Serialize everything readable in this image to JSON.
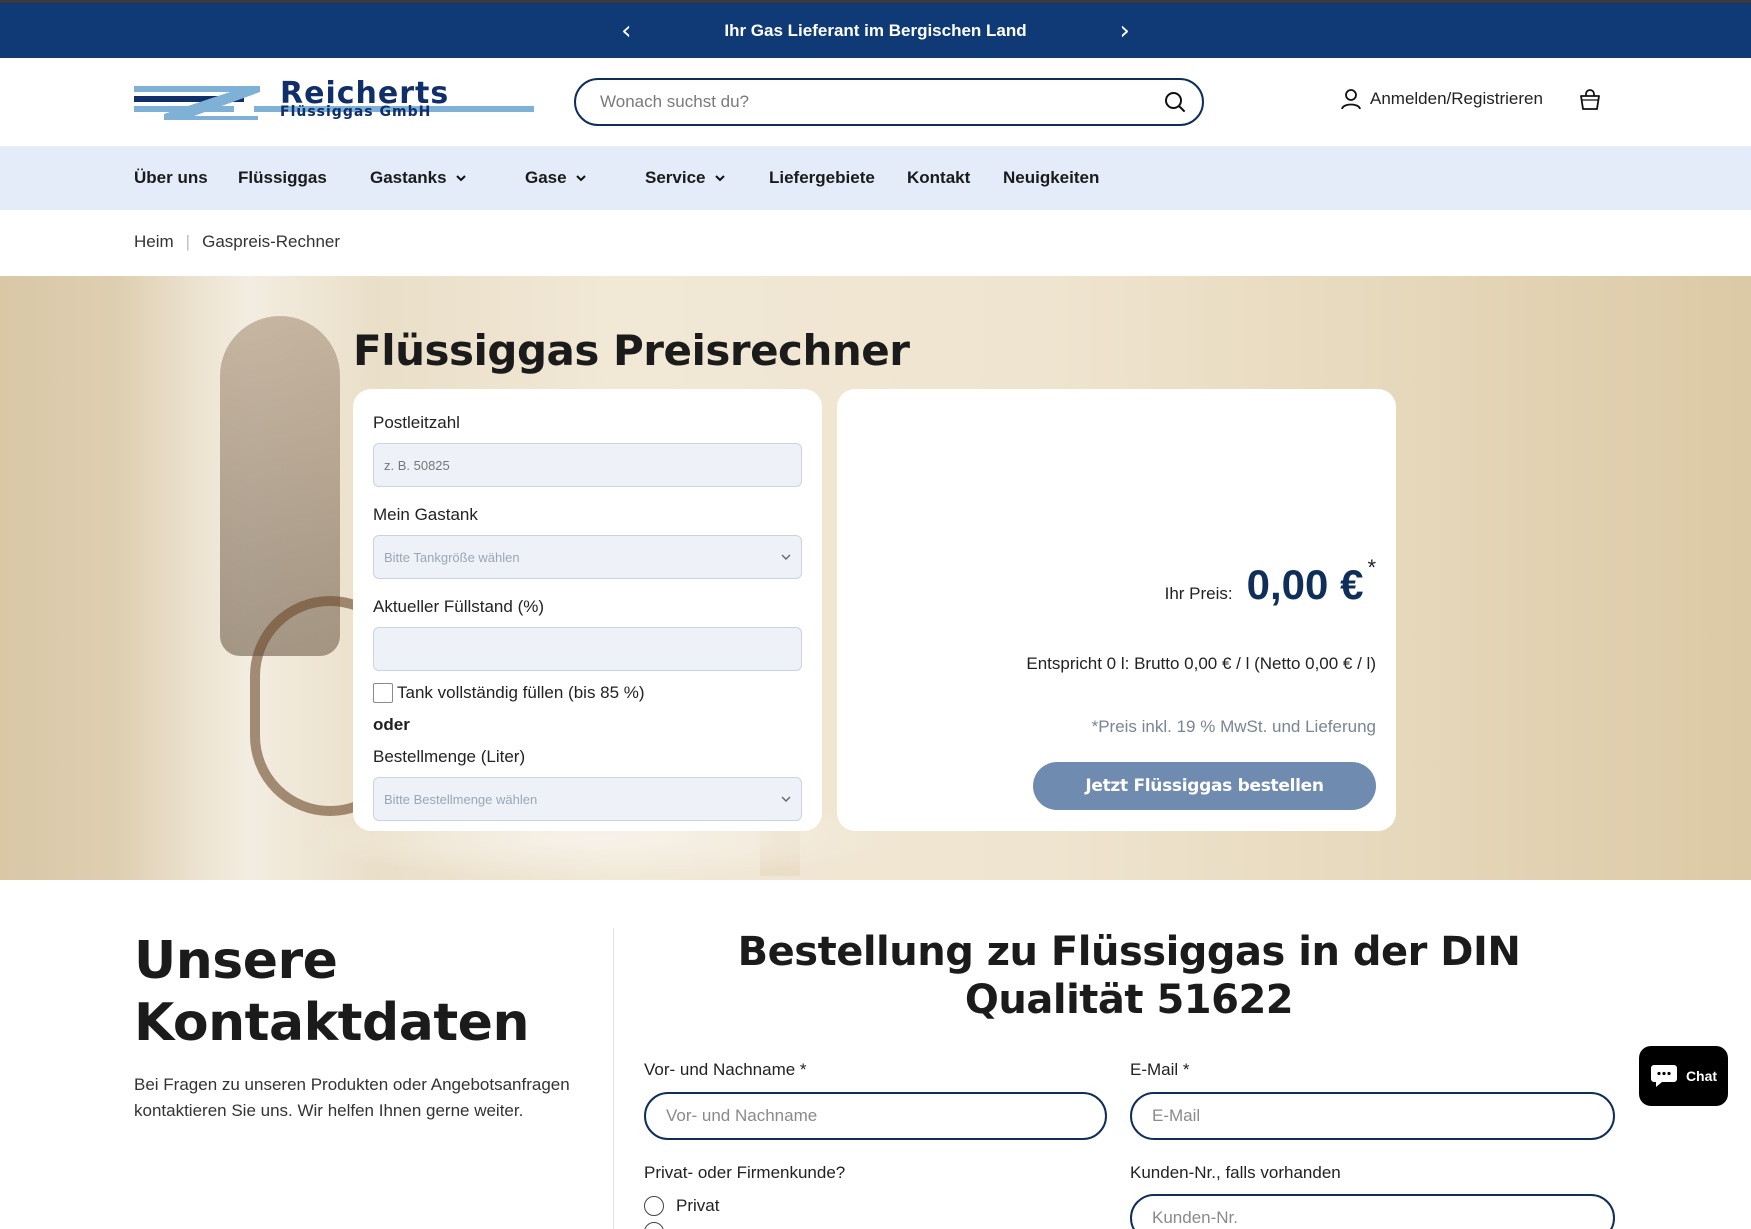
{
  "announcement": {
    "text": "Ihr Gas Lieferant im Bergischen Land",
    "prev": "‹",
    "next": "›"
  },
  "header": {
    "logo_main": "Reicherts",
    "logo_sub": "Flüssiggas GmbH",
    "search_placeholder": "Wonach suchst du?",
    "login_label": "Anmelden/Registrieren"
  },
  "nav": {
    "items": [
      {
        "label": "Über uns"
      },
      {
        "label": "Flüssiggas"
      },
      {
        "label": "Gastanks"
      },
      {
        "label": "Gase"
      },
      {
        "label": "Service"
      },
      {
        "label": "Liefergebiete"
      },
      {
        "label": "Kontakt"
      },
      {
        "label": "Neuigkeiten"
      }
    ]
  },
  "breadcrumb": {
    "home": "Heim",
    "current": "Gaspreis-Rechner"
  },
  "calculator": {
    "title": "Flüssiggas Preisrechner",
    "plz_label": "Postleitzahl",
    "plz_placeholder": "z. B. 50825",
    "tank_label": "Mein Gastank",
    "tank_select": "Bitte Tankgröße wählen",
    "level_label": "Aktueller Füllstand (%)",
    "fill_checkbox": "Tank vollständig füllen (bis 85 %)",
    "or": "oder",
    "amount_label": "Bestellmenge (Liter)",
    "amount_select": "Bitte Bestellmenge wählen",
    "price_label": "Ihr Preis:",
    "price_value": "0,00 €",
    "price_star": "*",
    "equivalent": "Entspricht 0 l: Brutto 0,00 € / l (Netto 0,00 € / l)",
    "note": "*Preis inkl. 19 % MwSt. und Lieferung",
    "order_button": "Jetzt Flüssiggas bestellen"
  },
  "contact": {
    "title_line1": "Unsere",
    "title_line2": "Kontaktdaten",
    "text": "Bei Fragen zu unseren Produkten oder Angebotsanfragen kontaktieren Sie uns. Wir helfen Ihnen gerne weiter."
  },
  "order_form": {
    "title": "Bestellung zu Flüssiggas in der DIN Qualität 51622",
    "name_label": "Vor- und Nachname *",
    "name_placeholder": "Vor- und Nachname",
    "email_label": "E-Mail *",
    "email_placeholder": "E-Mail",
    "customer_type_label": "Privat- oder Firmenkunde?",
    "option_private": "Privat",
    "customer_no_label": "Kunden-Nr., falls vorhanden",
    "customer_no_placeholder": "Kunden-Nr."
  },
  "chat": {
    "label": "Chat"
  },
  "colors": {
    "primary": "#0f3a75",
    "navy": "#0f2e5a",
    "nav_bg": "#e3ecf8",
    "button": "#6f8bb0"
  }
}
